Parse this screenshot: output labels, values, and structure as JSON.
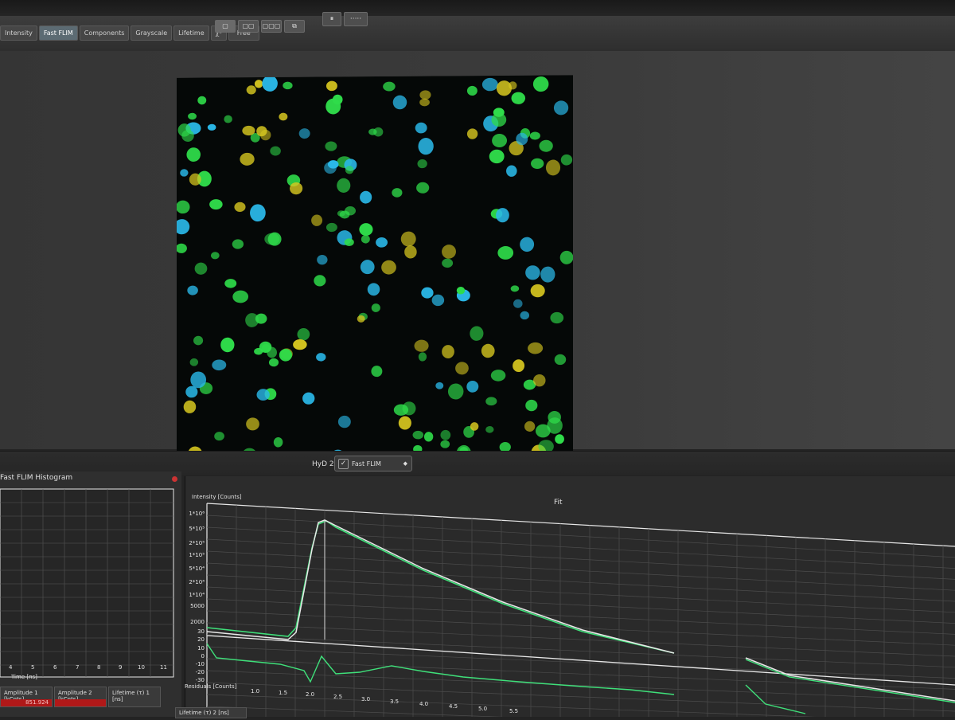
{
  "toolbar": {
    "tabs": [
      "Intensity",
      "Fast FLIM",
      "Components",
      "Grayscale",
      "Lifetime",
      "χ²",
      "Free"
    ],
    "view_buttons": [
      "▢",
      "▢▢",
      "▢▢▢",
      "⧉"
    ],
    "control_buttons": [
      "⏸",
      "·····"
    ]
  },
  "detector": {
    "label": "HyD 2",
    "selected": "Fast FLIM",
    "check_icon": "checkmark-icon",
    "arrow_icon": "chevron-updown-icon"
  },
  "histogram": {
    "title": "Fast FLIM Histogram",
    "xlabel": "Time [ns]",
    "ticks": [
      "4",
      "5",
      "6",
      "7",
      "8",
      "9",
      "10",
      "11"
    ]
  },
  "fit": {
    "title": "Fit",
    "ylabel": "Intensity [Counts]",
    "residual_label": "Residuals [Counts]",
    "yticks": [
      "1*10⁶",
      "5*10⁵",
      "2*10⁵",
      "1*10⁵",
      "5*10⁴",
      "2*10⁴",
      "1*10⁴",
      "5000",
      "2000",
      "30",
      "20",
      "10",
      "0",
      "-10",
      "-20",
      "-30"
    ],
    "xticks": [
      "1.0",
      "1.5",
      "2.0",
      "2.5",
      "3.0",
      "3.5",
      "4.0",
      "4.5",
      "5.0",
      "5.5"
    ]
  },
  "bottom_tabs": [
    {
      "label": "Amplitude 1 [kCnts]",
      "value": "851.924"
    },
    {
      "label": "Amplitude 2 [kCnts]",
      "value": ""
    },
    {
      "label": "Lifetime (τ) 1 [ns]",
      "value": ""
    }
  ],
  "bottom_tab_2": "Lifetime (τ) 2 [ns]",
  "colors": {
    "fit_curve": "#e8e8e8",
    "data_curve": "#3fe07a",
    "cell_green": "#2fdc4a",
    "cell_cyan": "#2ab8e8",
    "cell_yellow": "#d8c820"
  }
}
